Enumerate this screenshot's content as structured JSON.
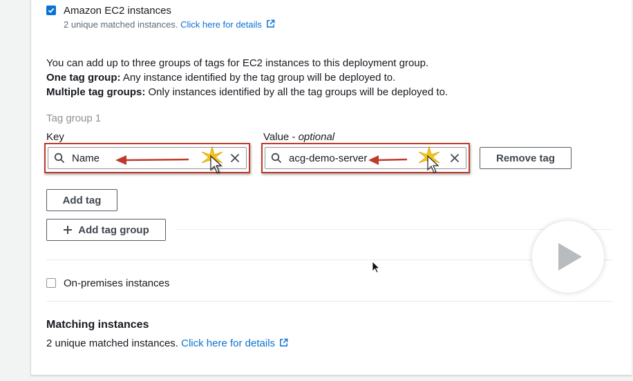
{
  "ec2": {
    "checkbox_label": "Amazon EC2 instances",
    "checked": true,
    "matched_text": "2 unique matched instances.",
    "details_link": "Click here for details"
  },
  "info": {
    "line1": "You can add up to three groups of tags for EC2 instances to this deployment group.",
    "one_group_label": "One tag group:",
    "one_group_text": " Any instance identified by the tag group will be deployed to.",
    "multi_group_label": "Multiple tag groups:",
    "multi_group_text": " Only instances identified by all the tag groups will be deployed to."
  },
  "tag_group": {
    "title": "Tag group 1",
    "key_label": "Key",
    "value_label": "Value - ",
    "value_optional": "optional",
    "key_value": "Name",
    "value_value": "acg-demo-server",
    "remove_tag": "Remove tag",
    "add_tag": "Add tag",
    "add_tag_group": "Add tag group"
  },
  "on_prem": {
    "checkbox_label": "On-premises instances",
    "checked": false
  },
  "matching": {
    "title": "Matching instances",
    "matched_text": "2 unique matched instances.",
    "details_link": "Click here for details"
  },
  "colors": {
    "accent": "#0972d3",
    "annotation_red": "#c0392b",
    "highlight_yellow": "#f5c518"
  },
  "icons": {
    "check": "check-icon",
    "search": "search-icon",
    "clear": "close-icon",
    "external": "external-link-icon",
    "plus": "plus-icon",
    "play": "play-icon",
    "cursor": "mouse-cursor-icon"
  }
}
